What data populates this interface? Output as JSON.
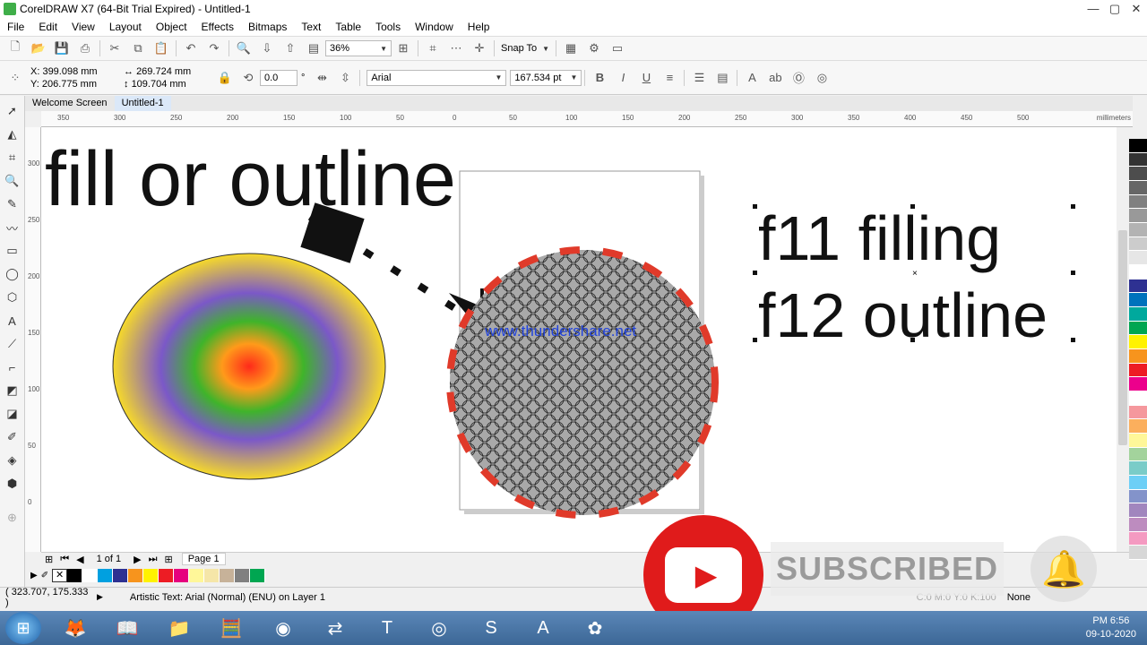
{
  "window": {
    "title": "CorelDRAW X7 (64-Bit Trial Expired) - Untitled-1",
    "controls": [
      "—",
      "▢",
      "✕"
    ]
  },
  "menu": [
    "File",
    "Edit",
    "View",
    "Layout",
    "Object",
    "Effects",
    "Bitmaps",
    "Text",
    "Table",
    "Tools",
    "Window",
    "Help"
  ],
  "standard_toolbar": {
    "zoom": "36%",
    "snap_to": "Snap To"
  },
  "property_bar": {
    "x": "X: 399.098 mm",
    "y": "Y: 206.775 mm",
    "width": "269.724 mm",
    "height": "109.704 mm",
    "rotation": "0.0",
    "degree_sign": "°",
    "font_name": "Arial",
    "font_size": "167.534 pt"
  },
  "tabs": [
    "Welcome Screen",
    "Untitled-1"
  ],
  "ruler": {
    "unit": "millimeters",
    "h_ticks": [
      "350",
      "300",
      "250",
      "200",
      "150",
      "100",
      "50",
      "0",
      "50",
      "100",
      "150",
      "200",
      "250",
      "300",
      "350",
      "400",
      "450",
      "500"
    ],
    "v_ticks": [
      "300",
      "250",
      "200",
      "150",
      "100",
      "50",
      "0"
    ]
  },
  "canvas": {
    "headline": "fill or outline",
    "watermark": "www.thundershare.net",
    "line1": "f11 filling",
    "line2": "f12 outline"
  },
  "doc_nav": {
    "page_count": "1 of 1",
    "page_tab": "Page 1"
  },
  "status": {
    "cursor": "( 323.707, 175.333 )",
    "selection": "Artistic Text: Arial (Normal) (ENU) on Layer 1",
    "fill_info": "C:0 M:0 Y:0 K:100",
    "outline": "None"
  },
  "overlay": {
    "subscribed": "SUBSCRIBED"
  },
  "taskbar": {
    "time": "PM 6:56",
    "date": "09-10-2020"
  },
  "colors": {
    "palette": [
      "#000000",
      "#333333",
      "#4d4d4d",
      "#666666",
      "#808080",
      "#999999",
      "#b3b3b3",
      "#cccccc",
      "#e6e6e6",
      "#ffffff",
      "#2e3192",
      "#0072bc",
      "#00a99d",
      "#00a651",
      "#fff200",
      "#f7941d",
      "#ed1c24",
      "#ec008c",
      "#ffffff",
      "#f5989d",
      "#fbaf5d",
      "#fff799",
      "#a3d39c",
      "#7accc8",
      "#6dcff6",
      "#8393ca",
      "#a186be",
      "#bd8cbf",
      "#f49ac1",
      "#d7d7d7"
    ],
    "doc_palette": [
      "#000000",
      "#ffffff",
      "#00a0e0",
      "#2e3192",
      "#f7941d",
      "#fff200",
      "#ed1c24",
      "#e6007e",
      "#fff799",
      "#f5e6a8",
      "#c7b299",
      "#808080",
      "#00a651"
    ]
  }
}
